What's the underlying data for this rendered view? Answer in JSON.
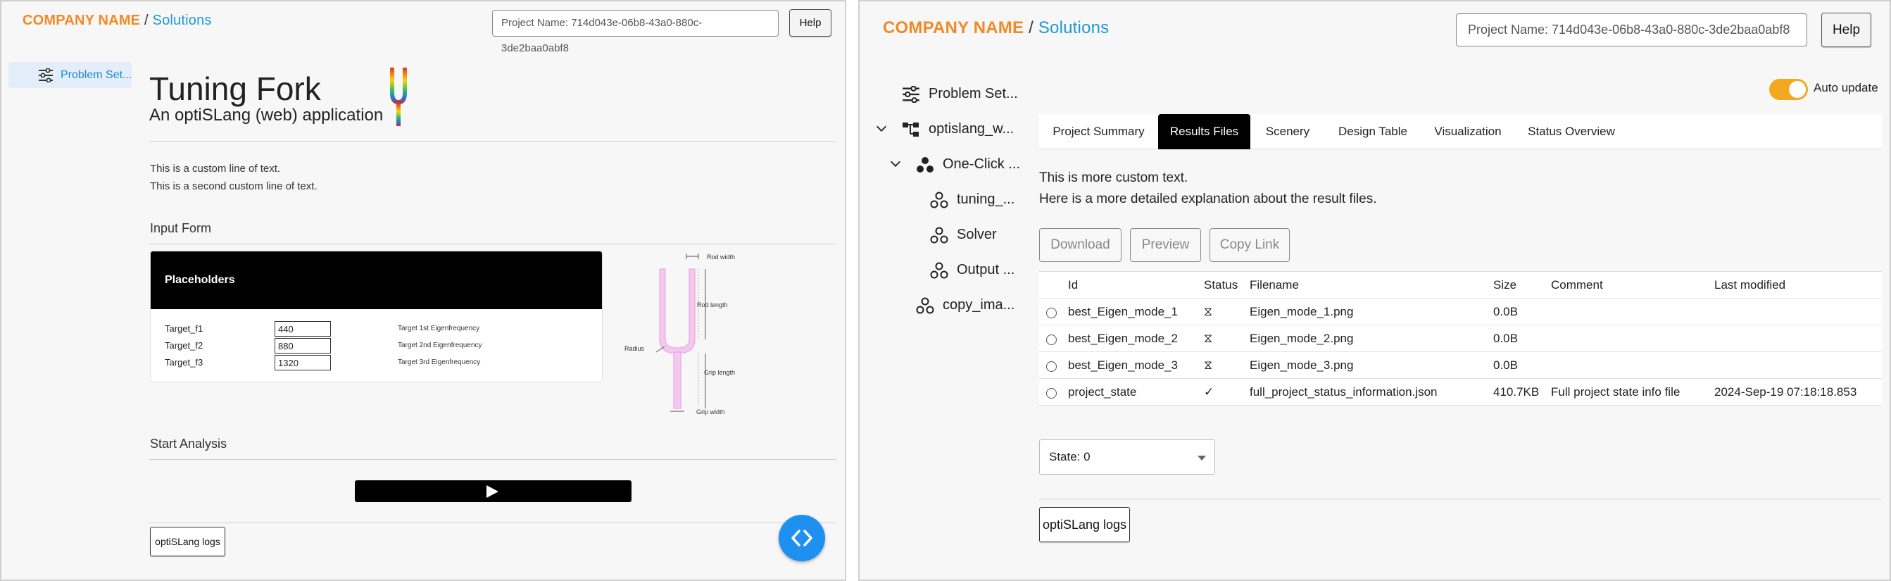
{
  "header": {
    "company": "COMPANY NAME",
    "separator": "/",
    "crumb": "Solutions",
    "project_name": "Project Name: 714d043e-06b8-43a0-880c-3de2baa0abf8",
    "help_label": "Help"
  },
  "left": {
    "nav_item": "Problem Set...",
    "title": "Tuning Fork",
    "subtitle": "An optiSLang (web) application",
    "custom_line_1": "This is a custom line of text.",
    "custom_line_2": "This is a second custom line of text.",
    "input_form_title": "Input Form",
    "placeholders_title": "Placeholders",
    "placeholders": [
      {
        "name": "Target_f1",
        "value": "440",
        "desc": "Target 1st Eigenfrequency"
      },
      {
        "name": "Target_f2",
        "value": "880",
        "desc": "Target 2nd Eigenfrequency"
      },
      {
        "name": "Target_f3",
        "value": "1320",
        "desc": "Target 3rd Eigenfrequency"
      }
    ],
    "diagram_labels": {
      "rod_width": "Rod width",
      "rod_length": "Rod length",
      "radius": "Radius",
      "grip_length": "Grip length",
      "grip_width": "Grip width"
    },
    "start_title": "Start Analysis",
    "logs_label": "optiSLang logs"
  },
  "right": {
    "tree": [
      {
        "label": "Problem Set...",
        "icon": "sliders-icon"
      },
      {
        "label": "optislang_w...",
        "icon": "hierarchy-icon"
      },
      {
        "label": "One-Click ...",
        "icon": "nodes-filled-icon"
      },
      {
        "label": "tuning_...",
        "icon": "nodes-outline-icon"
      },
      {
        "label": "Solver",
        "icon": "nodes-outline-icon"
      },
      {
        "label": "Output ...",
        "icon": "nodes-outline-icon"
      },
      {
        "label": "copy_ima...",
        "icon": "nodes-outline-icon"
      }
    ],
    "auto_update_label": "Auto update",
    "auto_update_on": true,
    "tabs": [
      "Project Summary",
      "Results Files",
      "Scenery",
      "Design Table",
      "Visualization",
      "Status Overview"
    ],
    "active_tab": "Results Files",
    "more_text_1": "This is more custom text.",
    "more_text_2": "Here is a more detailed explanation about the result files.",
    "buttons": {
      "download": "Download",
      "preview": "Preview",
      "copy_link": "Copy Link"
    },
    "table": {
      "columns": [
        "Id",
        "Status",
        "Filename",
        "Size",
        "Comment",
        "Last modified"
      ],
      "rows": [
        {
          "id": "best_Eigen_mode_1",
          "status": "⧖",
          "filename": "Eigen_mode_1.png",
          "size": "0.0B",
          "comment": "",
          "modified": ""
        },
        {
          "id": "best_Eigen_mode_2",
          "status": "⧖",
          "filename": "Eigen_mode_2.png",
          "size": "0.0B",
          "comment": "",
          "modified": ""
        },
        {
          "id": "best_Eigen_mode_3",
          "status": "⧖",
          "filename": "Eigen_mode_3.png",
          "size": "0.0B",
          "comment": "",
          "modified": ""
        },
        {
          "id": "project_state",
          "status": "✓",
          "filename": "full_project_status_information.json",
          "size": "410.7KB",
          "comment": "Full project state info file",
          "modified": "2024-Sep-19 07:18:18.853"
        }
      ]
    },
    "state_select": "State: 0",
    "logs_label": "optiSLang logs"
  },
  "colors": {
    "brand": "#f08a24",
    "crumb": "#1a9ad6",
    "toggle": "#f4a81d",
    "fab": "#1e90f0",
    "active_tab": "#000000"
  }
}
